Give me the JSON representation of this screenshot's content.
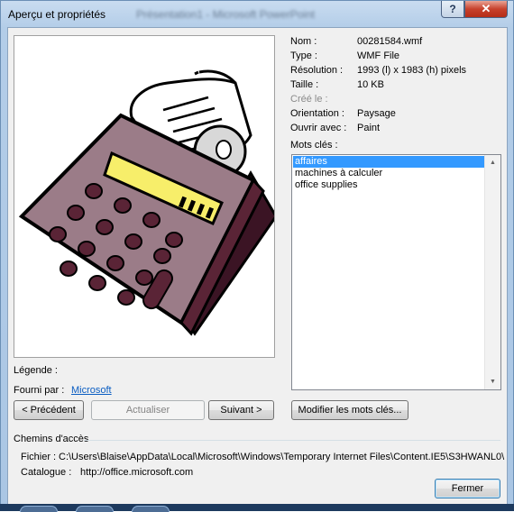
{
  "window": {
    "title": "Aperçu et propriétés",
    "blurred_title": "Présentation1 - Microsoft PowerPoint",
    "help_label": "?",
    "close_label": "✕"
  },
  "properties": [
    {
      "key": "nom",
      "label": "Nom :",
      "value": "00281584.wmf"
    },
    {
      "key": "type",
      "label": "Type :",
      "value": "WMF File"
    },
    {
      "key": "resolution",
      "label": "Résolution :",
      "value": "1993 (l) x 1983 (h) pixels"
    },
    {
      "key": "taille",
      "label": "Taille :",
      "value": "10 KB"
    },
    {
      "key": "cree",
      "label": "Créé le :",
      "value": ""
    },
    {
      "key": "orientation",
      "label": "Orientation :",
      "value": "Paysage"
    },
    {
      "key": "ouvrir",
      "label": "Ouvrir avec :",
      "value": "Paint"
    }
  ],
  "keywords": {
    "label": "Mots clés :",
    "items": [
      "affaires",
      "machines à calculer",
      "office supplies"
    ],
    "selected_index": 0
  },
  "legende": {
    "label": "Légende :",
    "value": ""
  },
  "fourni": {
    "label": "Fourni par :",
    "link": "Microsoft"
  },
  "buttons": {
    "precedent": "< Précédent",
    "actualiser": "Actualiser",
    "suivant": "Suivant >",
    "modifier": "Modifier les mots clés...",
    "fermer": "Fermer"
  },
  "paths": {
    "group_label": "Chemins d'accès",
    "fichier_label": "Fichier :",
    "fichier_value": "C:\\Users\\Blaise\\AppData\\Local\\Microsoft\\Windows\\Temporary Internet Files\\Content.IE5\\S3HWANL0\\",
    "catalogue_label": "Catalogue :",
    "catalogue_value": "http://office.microsoft.com"
  },
  "preview": {
    "icon": "calculator-clipart"
  }
}
